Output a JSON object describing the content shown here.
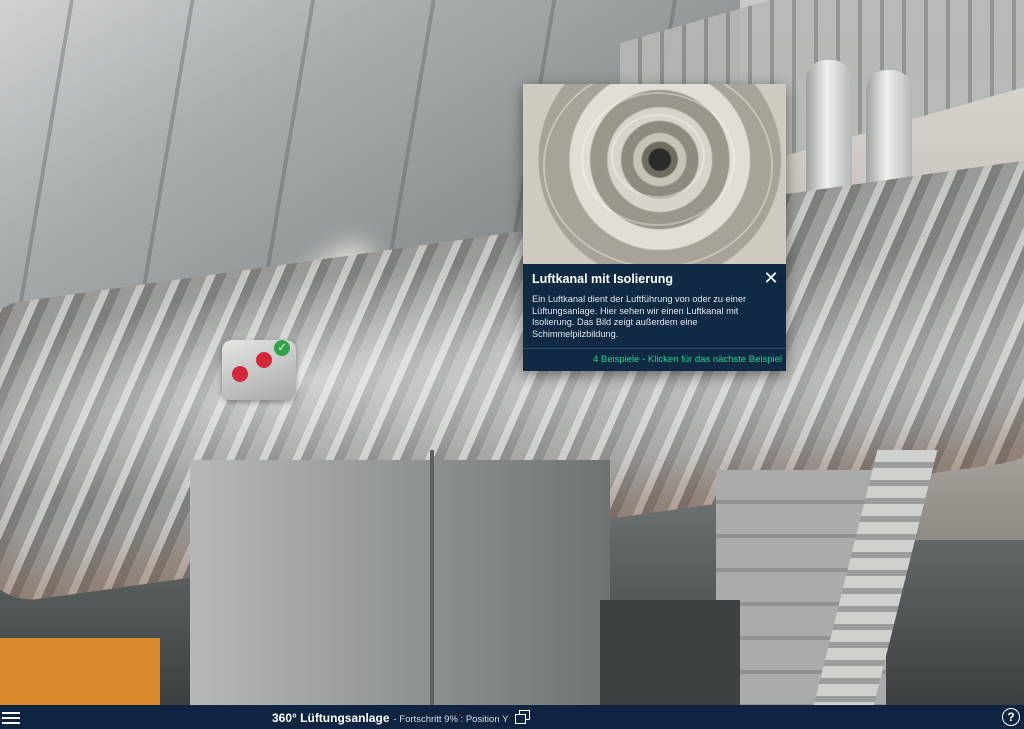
{
  "popup": {
    "title": "Luftkanal mit Isolierung",
    "close_icon": "close-icon",
    "description": "Ein Luftkanal dient der Luftführung von oder zu einer Lüftungsanlage. Hier sehen wir einen Luftkanal mit Isolierung. Das Bild zeigt außerdem eine Schimmelpilzbildung.",
    "next_link": "4 Beispiele - Klicken für das nächste Beispiel"
  },
  "toolbar": {
    "menu_icon": "hamburger-menu-icon",
    "title": "360° Lüftungsanlage",
    "status": "- Fortschritt 9% : Position Y",
    "view_icon": "gallery-icon",
    "help_label": "?"
  },
  "colors": {
    "toolbar_bg": "#0e2440",
    "popup_bg": "#102a44",
    "link_green": "#2bd08a"
  }
}
